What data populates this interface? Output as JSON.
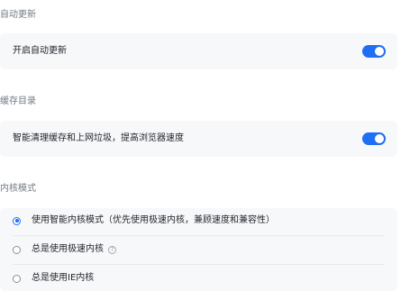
{
  "sections": {
    "auto_update": {
      "title": "自动更新",
      "row_label": "开启自动更新",
      "toggle_on": true
    },
    "cache": {
      "title": "缓存目录",
      "row_label": "智能清理缓存和上网垃圾，提高浏览器速度",
      "toggle_on": true
    },
    "kernel": {
      "title": "内核模式",
      "options": [
        {
          "label": "使用智能内核模式（优先使用极速内核，兼顾速度和兼容性）",
          "selected": true
        },
        {
          "label": "总是使用极速内核",
          "selected": false,
          "help_icon": "question-circle-icon"
        },
        {
          "label": "总是使用IE内核",
          "selected": false
        }
      ]
    }
  },
  "colors": {
    "accent": "#1f6ff5",
    "card_bg": "#f7f8fa",
    "section_title": "#737a87"
  }
}
